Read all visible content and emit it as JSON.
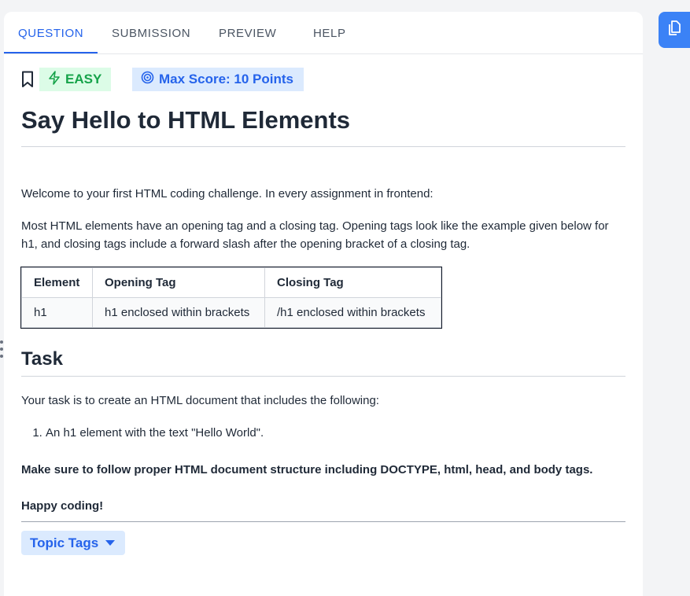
{
  "tabs": [
    {
      "label": "QUESTION",
      "active": true
    },
    {
      "label": "SUBMISSION",
      "active": false
    },
    {
      "label": "PREVIEW",
      "active": false
    },
    {
      "label": "HELP",
      "active": false
    }
  ],
  "badges": {
    "difficulty": "EASY",
    "max_score": "Max Score: 10 Points"
  },
  "problem": {
    "title": "Say Hello to HTML Elements",
    "intro": "Welcome to your first HTML coding challenge. In every assignment in frontend:",
    "description": "Most HTML elements have an opening tag and a closing tag. Opening tags look like the example given below for h1, and closing tags include a forward slash after the opening bracket of a closing tag.",
    "table": {
      "headers": [
        "Element",
        "Opening Tag",
        "Closing Tag"
      ],
      "rows": [
        [
          "h1",
          "h1 enclosed within brackets",
          "/h1 enclosed within brackets"
        ]
      ]
    },
    "task_heading": "Task",
    "task_intro": "Your task is to create an HTML document that includes the following:",
    "steps": [
      "An h1 element with the text \"Hello World\"."
    ],
    "note": "Make sure to follow proper HTML document structure including DOCTYPE, html, head, and body tags.",
    "closing": "Happy coding!"
  },
  "topic_tags_label": "Topic Tags",
  "colors": {
    "accent": "#2563eb",
    "easy_green": "#16a34a",
    "easy_bg": "#dcfce7",
    "blue_bg": "#dbeafe",
    "side_button": "#3b82f6"
  },
  "icons": {
    "bookmark": "bookmark-icon",
    "difficulty": "lightning-icon",
    "score": "target-icon",
    "dropdown": "caret-down-icon",
    "side": "document-icon"
  }
}
